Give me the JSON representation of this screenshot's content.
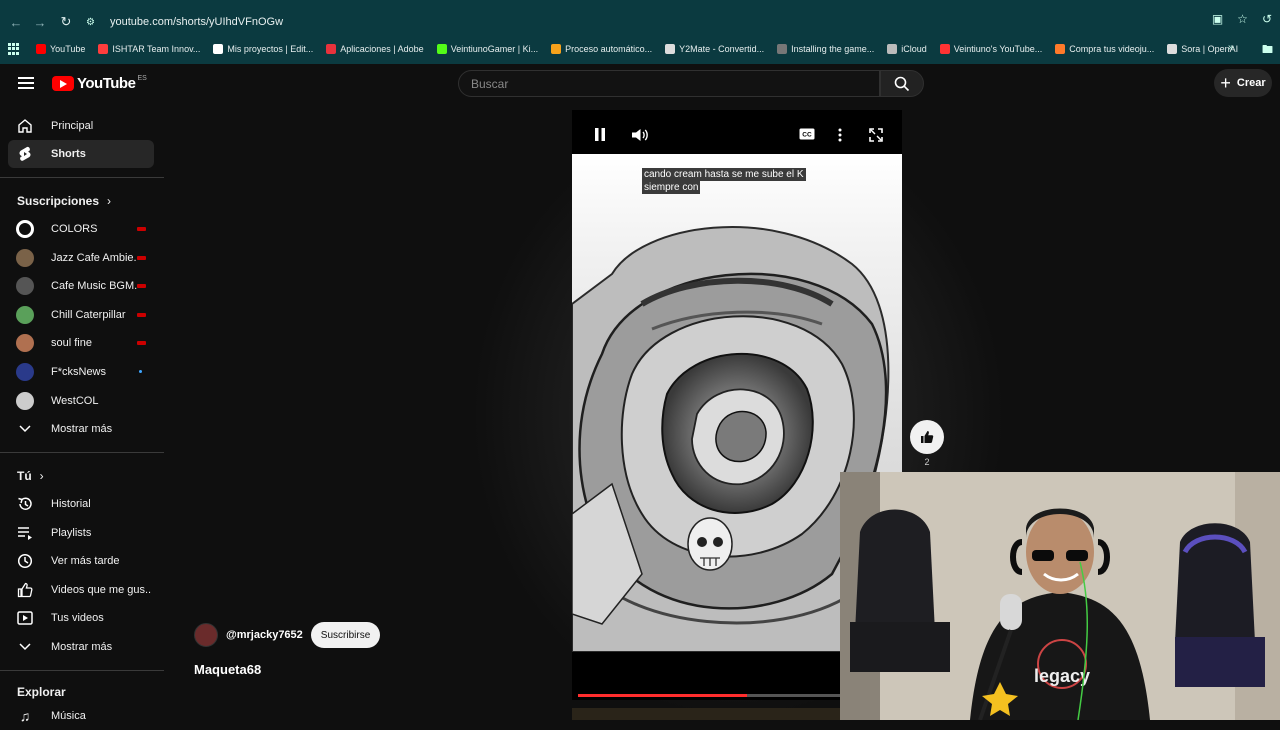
{
  "browser": {
    "url": "youtube.com/shorts/yUIhdVFnOGw",
    "bookmarks": [
      {
        "label": "YouTube",
        "color": "#ff0000"
      },
      {
        "label": "ISHTAR Team Innov...",
        "color": "#ff3d3d"
      },
      {
        "label": "Mis proyectos | Edit...",
        "color": "#ffffff"
      },
      {
        "label": "Aplicaciones | Adobe",
        "color": "#e8323c"
      },
      {
        "label": "VeintiunoGamer | Ki...",
        "color": "#53fc18"
      },
      {
        "label": "Proceso automático...",
        "color": "#f7a21b"
      },
      {
        "label": "Y2Mate - Convertid...",
        "color": "#dddddd"
      },
      {
        "label": "Installing the game...",
        "color": "#777777"
      },
      {
        "label": "iCloud",
        "color": "#bbbbbb"
      },
      {
        "label": "Veintiuno's YouTube...",
        "color": "#ff3333"
      },
      {
        "label": "Compra tus videoju...",
        "color": "#ff7a2a"
      },
      {
        "label": "Sora | OpenAI",
        "color": "#dddddd"
      }
    ]
  },
  "header": {
    "logo_text": "YouTube",
    "country": "ES",
    "search_placeholder": "Buscar",
    "create_label": "Crear"
  },
  "sidebar": {
    "main": [
      {
        "label": "Principal",
        "icon": "home-icon"
      },
      {
        "label": "Shorts",
        "icon": "shorts-icon"
      }
    ],
    "subscriptions_heading": "Suscripciones",
    "subscriptions": [
      {
        "label": "COLORS",
        "avatar": "#ffffff",
        "live": true
      },
      {
        "label": "Jazz Cafe Ambie...",
        "avatar": "#7a6248",
        "live": true
      },
      {
        "label": "Cafe Music BGM...",
        "avatar": "#555555",
        "live": true
      },
      {
        "label": "Chill Caterpillar",
        "avatar": "#5aa05a",
        "live": true
      },
      {
        "label": "soul fine",
        "avatar": "#b07050",
        "live": true
      },
      {
        "label": "F*cksNews",
        "avatar": "#2a3a8a",
        "live": false,
        "new": true
      },
      {
        "label": "WestCOL",
        "avatar": "#cccccc",
        "live": false
      }
    ],
    "show_more_1": "Mostrar más",
    "you_heading": "Tú",
    "you_items": [
      {
        "label": "Historial",
        "icon": "history-icon"
      },
      {
        "label": "Playlists",
        "icon": "playlists-icon"
      },
      {
        "label": "Ver más tarde",
        "icon": "clock-icon"
      },
      {
        "label": "Videos que me gus...",
        "icon": "thumbs-up-icon"
      },
      {
        "label": "Tus videos",
        "icon": "video-icon"
      }
    ],
    "show_more_2": "Mostrar más",
    "explore_heading": "Explorar",
    "explore_items": [
      {
        "label": "Música",
        "icon": "music-icon"
      }
    ]
  },
  "player": {
    "caption_lines": [
      "cando cream hasta se me sube el K",
      "siempre con"
    ],
    "progress_fraction": 0.53,
    "like_count": "2"
  },
  "channel": {
    "handle": "@mrjacky7652",
    "subscribe_label": "Suscribirse",
    "video_title": "Maqueta68"
  }
}
